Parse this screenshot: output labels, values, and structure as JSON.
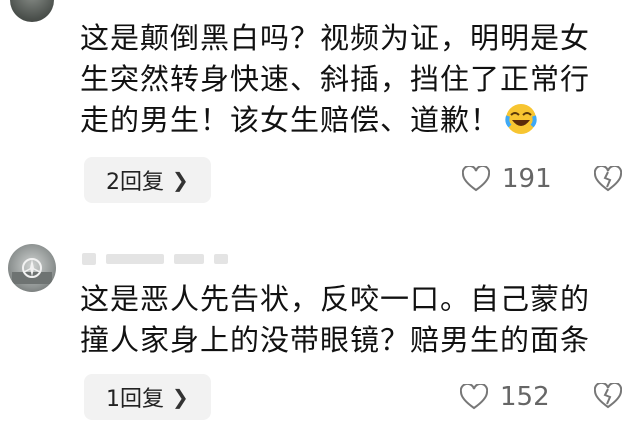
{
  "comments": [
    {
      "text": "这是颠倒黑白吗？视频为证，明明是女\n生突然转身快速、斜插，挡住了正常行\n走的男生！该女生赔偿、道歉！",
      "emoji": "laughing-crying-emoji",
      "reply_label": "2回复",
      "likes": "191"
    },
    {
      "text": "这是恶人先告状，反咬一口。自己蒙的\n撞人家身上的没带眼镜？赔男生的面条",
      "reply_label": "1回复",
      "likes": "152"
    }
  ],
  "icons": {
    "like": "heart-outline-icon",
    "dislike": "broken-heart-icon",
    "chevron": "chevron-right-icon"
  },
  "colors": {
    "text": "#111111",
    "muted": "#666666",
    "reply_bg": "#f2f2f2"
  }
}
